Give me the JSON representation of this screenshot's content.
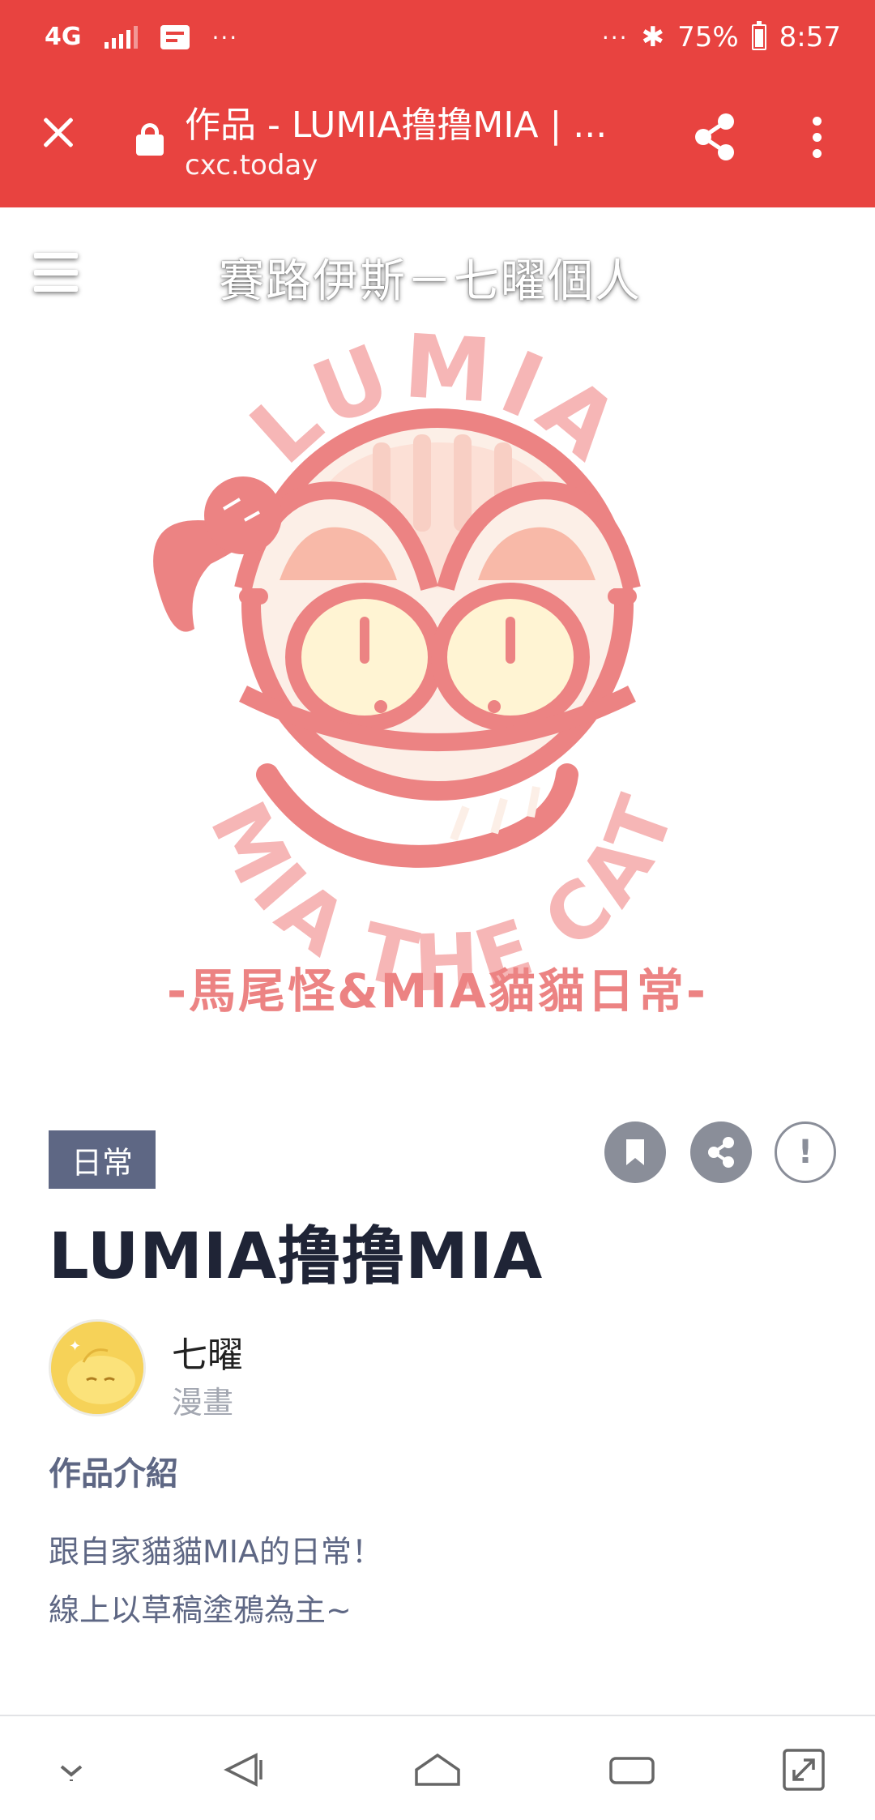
{
  "status_bar": {
    "network": "4G",
    "dots_left": "···",
    "dots_right": "···",
    "battery": "75%",
    "time": "8:57"
  },
  "browser": {
    "page_title": "作品 - LUMIA撸撸MIA | ...",
    "url": "cxc.today",
    "icons": [
      "close-icon",
      "lock-icon",
      "share-icon",
      "more-vert-icon"
    ]
  },
  "site": {
    "title": "賽路伊斯－七曜個人"
  },
  "cover": {
    "logo_top_text": "LUMIA",
    "logo_bottom_text": "MIA THE CAT",
    "tagline": "-馬尾怪&MIA貓貓日常-",
    "accent_color": "#ec8383"
  },
  "work": {
    "category": "日常",
    "title": "LUMIA撸撸MIA",
    "report_label": "!",
    "author": {
      "name": "七曜",
      "type": "漫畫"
    },
    "intro_heading": "作品介紹",
    "intro_lines": [
      "跟自家貓貓MIA的日常！",
      "線上以草稿塗鴉為主~"
    ]
  },
  "colors": {
    "chrome": "#e84340",
    "tag_bg": "#5e6784",
    "title": "#1f2436"
  },
  "bottom_nav": [
    "chevron-down-icon",
    "back-icon",
    "home-icon",
    "recents-icon",
    "expand-icon"
  ]
}
